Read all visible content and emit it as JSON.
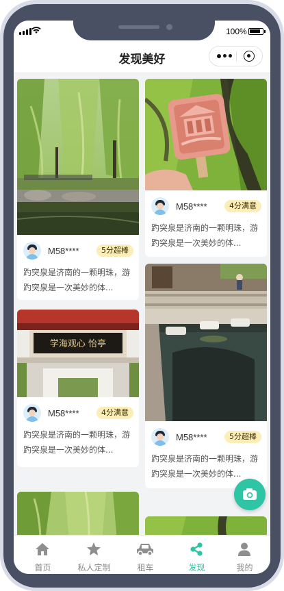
{
  "status_bar": {
    "battery": "100%"
  },
  "header": {
    "title": "发现美好"
  },
  "feed": {
    "cards": [
      {
        "user": "M58****",
        "badge": "5分超棒",
        "text": "趵突泉是济南的一颗明珠，游趵突泉是一次美妙的体..."
      },
      {
        "user": "M58****",
        "badge": "4分满意",
        "text": "趵突泉是济南的一颗明珠，游趵突泉是一次美妙的体..."
      },
      {
        "user": "M58****",
        "badge": "4分满意",
        "text": "趵突泉是济南的一颗明珠，游趵突泉是一次美妙的体..."
      },
      {
        "user": "M58****",
        "badge": "5分超棒",
        "text": "趵突泉是济南的一颗明珠，游趵突泉是一次美妙的体..."
      }
    ],
    "plaque_text": "学海观心 怡亭"
  },
  "fab": {
    "icon": "camera-icon"
  },
  "tabbar": {
    "tabs": [
      {
        "label": "首页",
        "icon": "home-icon"
      },
      {
        "label": "私人定制",
        "icon": "star-icon"
      },
      {
        "label": "租车",
        "icon": "car-icon"
      },
      {
        "label": "发现",
        "icon": "share-icon"
      },
      {
        "label": "我的",
        "icon": "user-icon"
      }
    ],
    "active_index": 3,
    "active_color": "#2ec4a4",
    "inactive_color": "#888888"
  }
}
